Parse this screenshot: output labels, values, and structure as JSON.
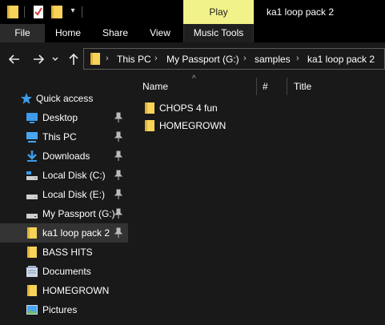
{
  "window": {
    "title": "ka1 loop pack 2",
    "context_tab": "Play",
    "accent_color": "#f2f28a"
  },
  "ribbon": {
    "tabs": [
      "File",
      "Home",
      "Share",
      "View",
      "Music Tools"
    ]
  },
  "address_bar": {
    "crumbs": [
      "This PC",
      "My Passport (G:)",
      "samples",
      "ka1 loop pack 2"
    ]
  },
  "columns": [
    "Name",
    "#",
    "Title"
  ],
  "sidebar": {
    "quick_access": "Quick access",
    "items": [
      {
        "label": "Desktop",
        "icon": "desktop-icon",
        "pinned": true
      },
      {
        "label": "This PC",
        "icon": "computer-icon",
        "pinned": true
      },
      {
        "label": "Downloads",
        "icon": "download-icon",
        "pinned": true
      },
      {
        "label": "Local Disk (C:)",
        "icon": "disk-icon",
        "pinned": true
      },
      {
        "label": "Local Disk (E:)",
        "icon": "disk-icon",
        "pinned": true
      },
      {
        "label": "My Passport (G:)",
        "icon": "drive-icon",
        "pinned": true
      },
      {
        "label": "ka1 loop pack 2",
        "icon": "folder-icon",
        "pinned": true,
        "selected": true
      },
      {
        "label": "BASS HITS",
        "icon": "folder-icon",
        "pinned": false
      },
      {
        "label": "Documents",
        "icon": "documents-icon",
        "pinned": false
      },
      {
        "label": "HOMEGROWN",
        "icon": "folder-icon",
        "pinned": false
      },
      {
        "label": "Pictures",
        "icon": "pictures-icon",
        "pinned": false
      }
    ]
  },
  "files": [
    {
      "name": "CHOPS 4 fun",
      "icon": "folder-icon"
    },
    {
      "name": "HOMEGROWN",
      "icon": "folder-icon"
    }
  ]
}
